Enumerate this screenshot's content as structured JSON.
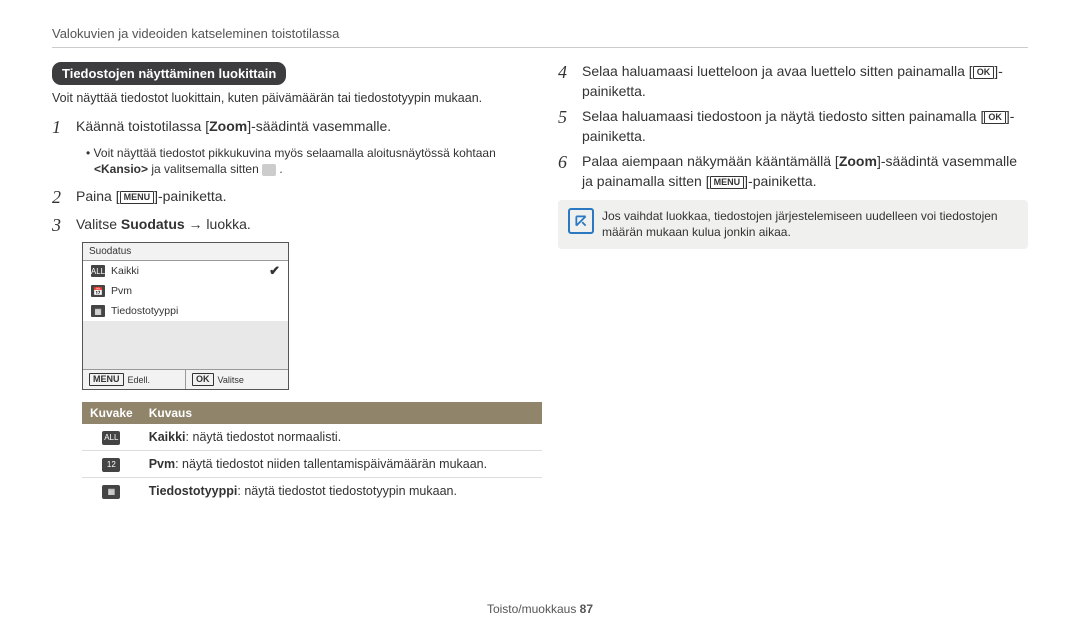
{
  "breadcrumb": "Valokuvien ja videoiden katseleminen toistotilassa",
  "section_title": "Tiedostojen näyttäminen luokittain",
  "intro": "Voit näyttää tiedostot luokittain, kuten päivämäärän tai tiedostotyypin mukaan.",
  "left_steps": {
    "s1_pre": "Käännä toistotilassa [",
    "s1_zoom": "Zoom",
    "s1_post": "]-säädintä vasemmalle.",
    "s1_bullet_pre": "Voit näyttää tiedostot pikkukuvina myös selaamalla aloitusnäytössä kohtaan ",
    "s1_bullet_kansio": "<Kansio>",
    "s1_bullet_post": " ja valitsemalla sitten ",
    "s2_pre": "Paina [",
    "s2_menu": "MENU",
    "s2_post": "]-painiketta.",
    "s3_pre": "Valitse ",
    "s3_bold": "Suodatus",
    "s3_post": " → luokka."
  },
  "ui_box": {
    "title": "Suodatus",
    "rows": [
      {
        "icon": "ALL",
        "label": "Kaikki",
        "selected": true
      },
      {
        "icon": "📅",
        "label": "Pvm",
        "selected": false
      },
      {
        "icon": "▦",
        "label": "Tiedostotyyppi",
        "selected": false
      }
    ],
    "footer_left_btn": "MENU",
    "footer_left": "Edell.",
    "footer_right_btn": "OK",
    "footer_right": "Valitse"
  },
  "desc_table": {
    "h1": "Kuvake",
    "h2": "Kuvaus",
    "rows": [
      {
        "icon": "ALL",
        "b": "Kaikki",
        "t": ": näytä tiedostot normaalisti."
      },
      {
        "icon": "12",
        "b": "Pvm",
        "t": ": näytä tiedostot niiden tallentamispäivämäärän mukaan."
      },
      {
        "icon": "▦",
        "b": "Tiedostotyyppi",
        "t": ": näytä tiedostot tiedostotyypin mukaan."
      }
    ]
  },
  "right_steps": {
    "s4_pre": "Selaa haluamaasi luetteloon ja avaa luettelo sitten painamalla [",
    "s4_post": "]-painiketta.",
    "s5_pre": "Selaa haluamaasi tiedostoon ja näytä tiedosto sitten painamalla [",
    "s5_post": "]-painiketta.",
    "s6_pre": "Palaa aiempaan näkymään kääntämällä [",
    "s6_zoom": "Zoom",
    "s6_mid": "]-säädintä vasemmalle ja painamalla sitten [",
    "s6_post": "]-painiketta."
  },
  "btn": {
    "ok": "OK",
    "menu": "MENU"
  },
  "note": "Jos vaihdat luokkaa, tiedostojen järjestelemiseen uudelleen voi tiedostojen määrän mukaan kulua jonkin aikaa.",
  "footer_pre": "Toisto/muokkaus  ",
  "footer_num": "87"
}
